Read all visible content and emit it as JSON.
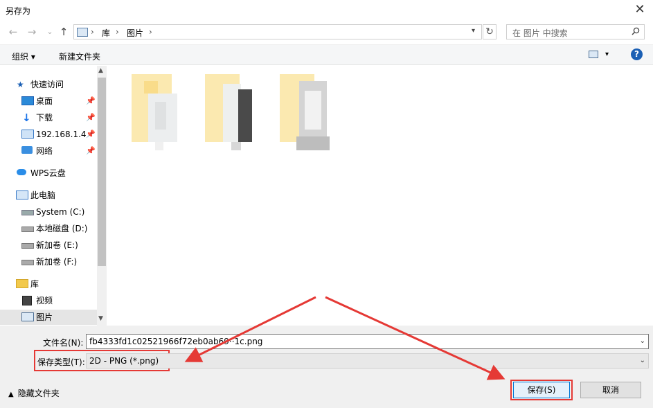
{
  "window": {
    "title": "另存为",
    "close_glyph": "✕"
  },
  "nav": {
    "back": "←",
    "forward": "→",
    "recent": "⌄",
    "up": "↑"
  },
  "address": {
    "seg1": "库",
    "seg2": "图片",
    "sep": "›"
  },
  "search": {
    "placeholder": "在 图片 中搜索"
  },
  "toolbar": {
    "organize": "组织 ▾",
    "new_folder": "新建文件夹",
    "help": "?"
  },
  "sidebar": {
    "items": [
      {
        "label": "快速访问"
      },
      {
        "label": "桌面"
      },
      {
        "label": "下载"
      },
      {
        "label": "192.168.1.4"
      },
      {
        "label": "网络"
      },
      {
        "label": "WPS云盘"
      },
      {
        "label": "此电脑"
      },
      {
        "label": "System (C:)"
      },
      {
        "label": "本地磁盘 (D:)"
      },
      {
        "label": "新加卷 (E:)"
      },
      {
        "label": "新加卷 (F:)"
      },
      {
        "label": "库"
      },
      {
        "label": "视频"
      },
      {
        "label": "图片"
      }
    ]
  },
  "form": {
    "filename_label": "文件名(N):",
    "filename_value": "fb4333fd1c02521966f72eb0ab69··1c.png",
    "filetype_label": "保存类型(T):",
    "filetype_value": "2D - PNG (*.png)"
  },
  "buttons": {
    "save": "保存(S)",
    "cancel": "取消",
    "hide_folders": "隐藏文件夹"
  },
  "colors": {
    "accent": "#1a5fb4",
    "annotation": "#e53935"
  }
}
